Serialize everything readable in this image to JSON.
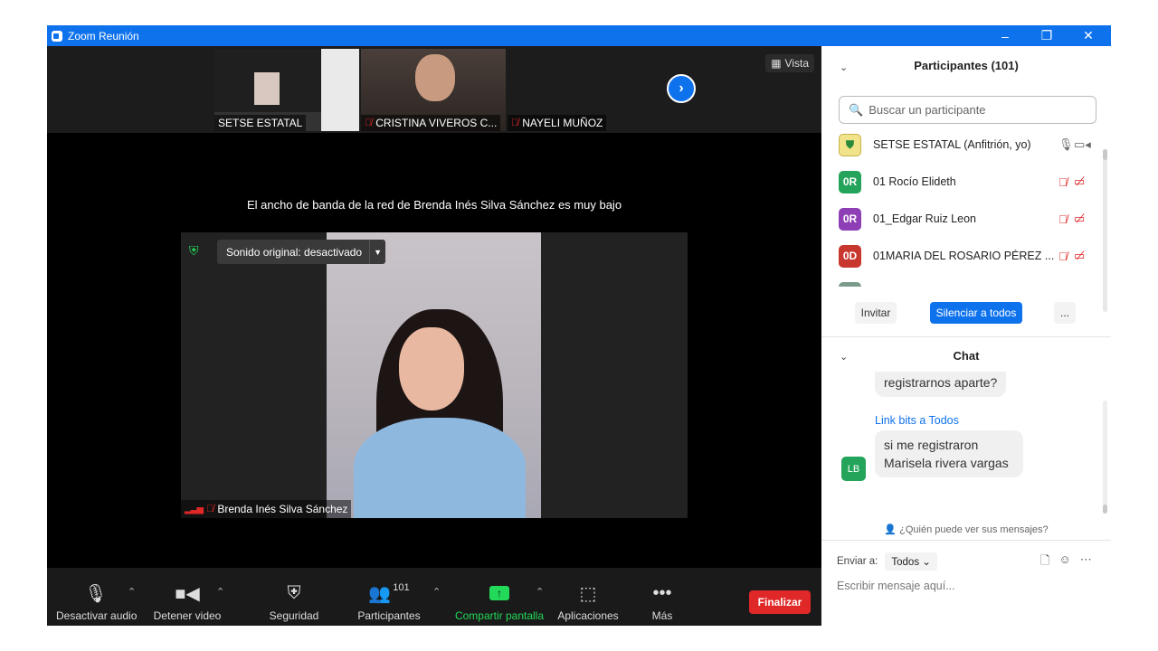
{
  "window": {
    "title": "Zoom Reunión",
    "controls": {
      "minimize": "–",
      "restore": "❐",
      "close": "✕"
    }
  },
  "filmstrip": {
    "thumbs": [
      {
        "name": "SETSE ESTATAL",
        "muted": false
      },
      {
        "name": "CRISTINA VIVEROS C...",
        "muted": true
      },
      {
        "name": "NAYELI MUÑOZ",
        "muted": true
      }
    ],
    "view_label": "Vista"
  },
  "banner": "El ancho de banda de la red de Brenda Inés Silva Sánchez es muy bajo",
  "speaker": {
    "original_sound": "Sonido original: desactivado",
    "name": "Brenda Inés Silva Sánchez"
  },
  "toolbar": {
    "audio": "Desactivar audio",
    "video": "Detener video",
    "security": "Seguridad",
    "participants": "Participantes",
    "participants_count": "101",
    "share": "Compartir pantalla",
    "apps": "Aplicaciones",
    "more": "Más",
    "end": "Finalizar"
  },
  "participants_panel": {
    "title": "Participantes (101)",
    "search_placeholder": "Buscar un participante",
    "list": [
      {
        "initials": "",
        "name": "SETSE ESTATAL (Anfitrión, yo)",
        "color": "#f1e38a"
      },
      {
        "initials": "0R",
        "name": "01 Rocío Elideth",
        "color": "#23a45a"
      },
      {
        "initials": "0R",
        "name": "01_Edgar Ruiz Leon",
        "color": "#8e3fb5"
      },
      {
        "initials": "0D",
        "name": "01MARIA DEL ROSARIO PÉREZ ...",
        "color": "#c8372d"
      }
    ],
    "invite": "Invitar",
    "mute_all": "Silenciar a todos",
    "more": "..."
  },
  "chat": {
    "title": "Chat",
    "prev_message": "registrarnos aparte?",
    "sender": "Link bits a Todos",
    "sender_initials": "LB",
    "message_line1": "si me registraron",
    "message_line2": "Marisela rivera vargas",
    "who_can_see": "¿Quién puede ver sus mensajes?",
    "send_to_label": "Enviar a:",
    "send_to_value": "Todos",
    "input_placeholder": "Escribir mensaje aquí..."
  }
}
